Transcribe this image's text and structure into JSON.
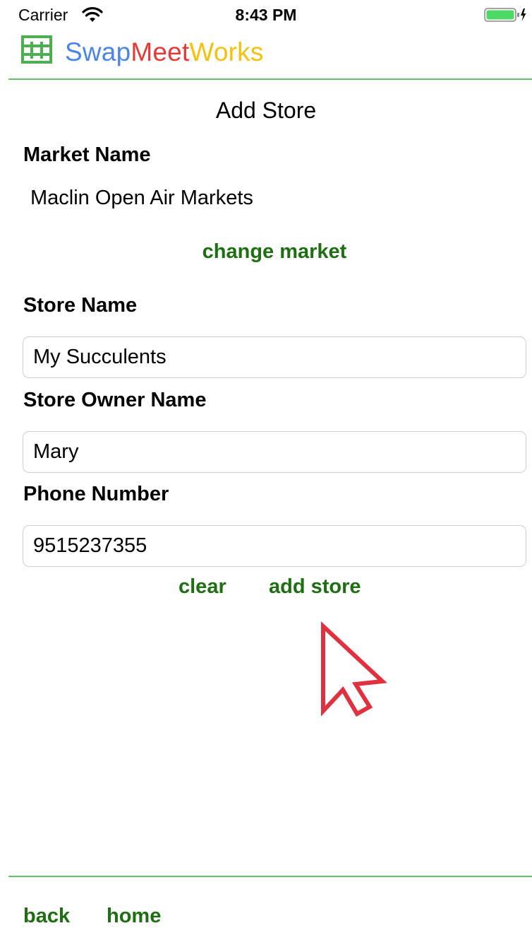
{
  "status_bar": {
    "carrier": "Carrier",
    "time": "8:43 PM",
    "wifi_icon": "wifi-icon",
    "battery_icon": "battery-charging-icon"
  },
  "app": {
    "logo_icon": "swapmeet-grid-logo-icon",
    "title_part1": "Swap",
    "title_part2": "Meet",
    "title_part3": "Works",
    "colors": {
      "part1": "#4a86e8",
      "part2": "#e53935",
      "part3": "#f4c20d",
      "accent_green": "#1e6e12",
      "divider": "#66c266"
    }
  },
  "page": {
    "title": "Add Store"
  },
  "market": {
    "label": "Market Name",
    "value": "Maclin Open Air Markets",
    "change_label": "change market"
  },
  "form": {
    "store_name_label": "Store Name",
    "store_name_value": "My Succulents",
    "owner_label": "Store Owner Name",
    "owner_value": "Mary",
    "phone_label": "Phone Number",
    "phone_value": "9515237355"
  },
  "actions": {
    "clear_label": "clear",
    "add_store_label": "add store"
  },
  "footer": {
    "back_label": "back",
    "home_label": "home"
  }
}
